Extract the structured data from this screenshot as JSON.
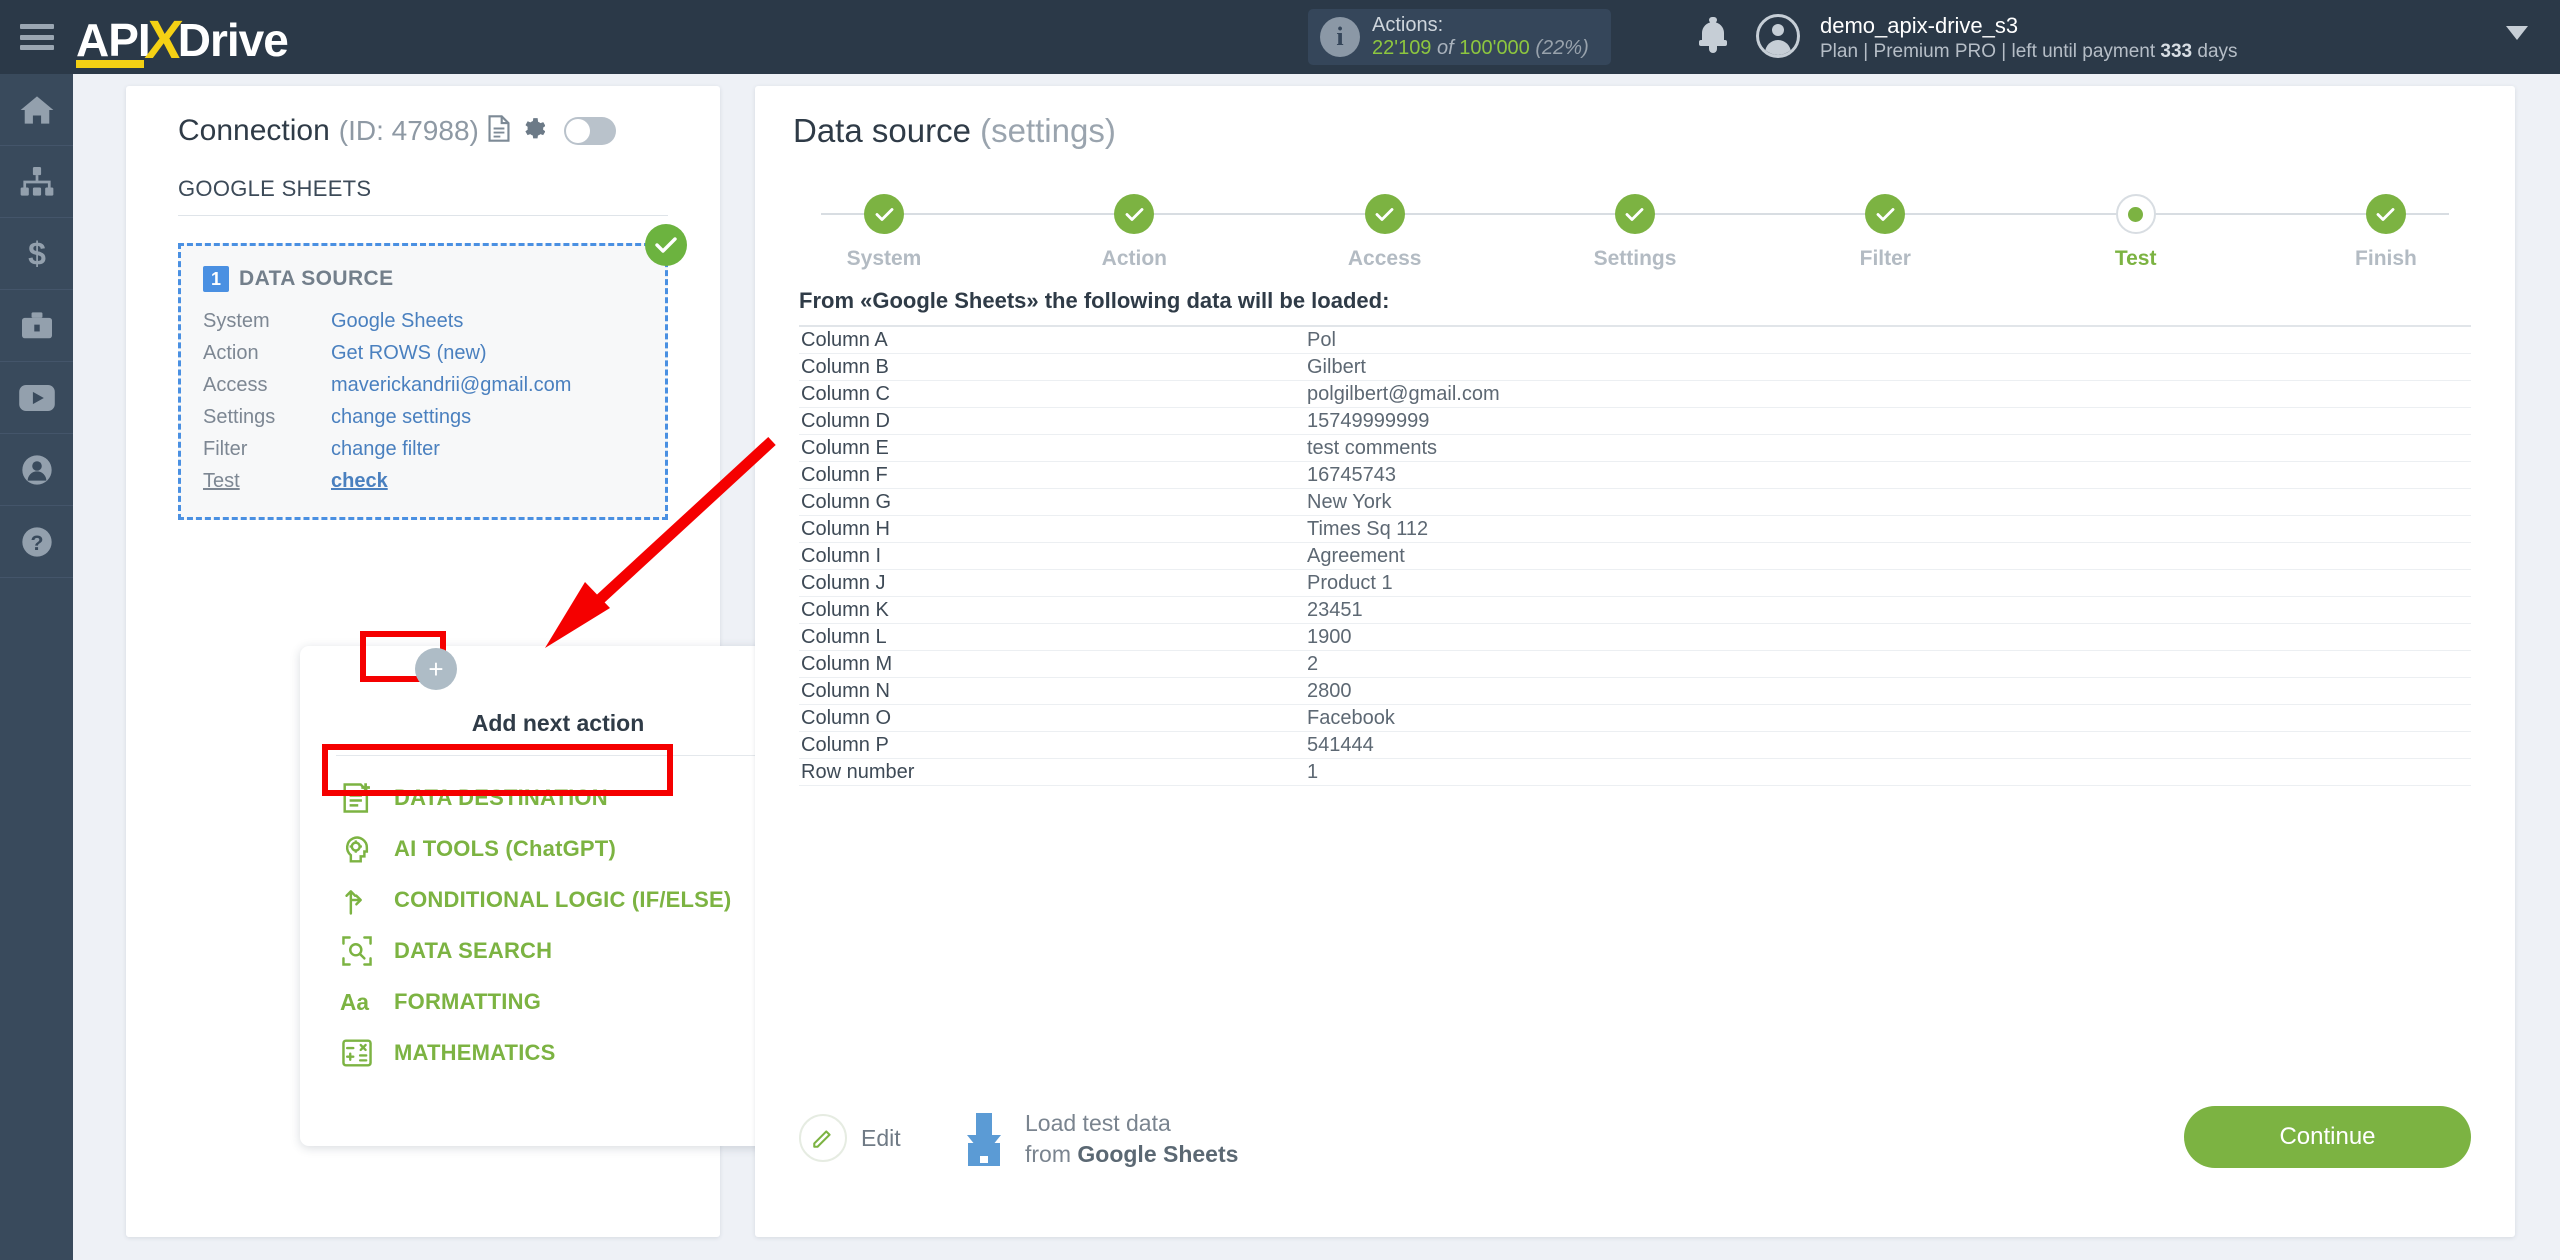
{
  "topbar": {
    "menu_icon": "hamburger-icon",
    "logo": {
      "part1": "API",
      "x": "X",
      "part2": "Drive"
    },
    "actions": {
      "label": "Actions:",
      "used": "22'109",
      "of": "of",
      "total": "100'000",
      "percent": "(22%)",
      "info_icon": "info-icon"
    },
    "bell_icon": "notification-bell-icon",
    "avatar_icon": "user-avatar-icon",
    "user": {
      "name": "demo_apix-drive_s3",
      "plan_prefix": "Plan |",
      "plan_name": "Premium PRO",
      "plan_suffix": "| left until payment",
      "days_count": "333",
      "days_word": "days"
    },
    "caret_icon": "chevron-down-icon"
  },
  "rail": {
    "items": [
      {
        "name": "home-icon"
      },
      {
        "name": "connections-icon"
      },
      {
        "name": "billing-icon"
      },
      {
        "name": "briefcase-icon"
      },
      {
        "name": "youtube-icon"
      },
      {
        "name": "account-icon"
      },
      {
        "name": "help-icon"
      }
    ]
  },
  "left_panel": {
    "connection_title": "Connection",
    "connection_id": "(ID: 47988)",
    "doc_icon": "document-icon",
    "gear_icon": "gear-icon",
    "toggle": "connection-toggle",
    "system_label": "GOOGLE SHEETS",
    "data_source_card": {
      "number": "1",
      "title": "DATA SOURCE",
      "check_icon": "check-circle-icon",
      "rows": [
        {
          "key": "System",
          "value": "Google Sheets"
        },
        {
          "key": "Action",
          "value": "Get ROWS (new)"
        },
        {
          "key": "Access",
          "value": "maverickandrii@gmail.com"
        },
        {
          "key": "Settings",
          "value": "change settings"
        },
        {
          "key": "Filter",
          "value": "change filter"
        },
        {
          "key": "Test",
          "value": "check"
        }
      ]
    },
    "plus_button": "+",
    "add_next_action": {
      "title": "Add next action",
      "items": [
        {
          "label": "DATA DESTINATION",
          "icon": "data-destination-icon"
        },
        {
          "label": "AI TOOLS (ChatGPT)",
          "icon": "ai-tools-icon"
        },
        {
          "label": "CONDITIONAL LOGIC (IF/ELSE)",
          "icon": "conditional-logic-icon"
        },
        {
          "label": "DATA SEARCH",
          "icon": "data-search-icon"
        },
        {
          "label": "FORMATTING",
          "icon": "formatting-icon"
        },
        {
          "label": "MATHEMATICS",
          "icon": "mathematics-icon"
        }
      ]
    }
  },
  "main": {
    "title": "Data source",
    "title_sub": "(settings)",
    "steps": [
      {
        "label": "System",
        "state": "done"
      },
      {
        "label": "Action",
        "state": "done"
      },
      {
        "label": "Access",
        "state": "done"
      },
      {
        "label": "Settings",
        "state": "done"
      },
      {
        "label": "Filter",
        "state": "done"
      },
      {
        "label": "Test",
        "state": "current"
      },
      {
        "label": "Finish",
        "state": "done"
      }
    ],
    "from_line": "From «Google Sheets» the following data will be loaded:",
    "table": [
      {
        "field": "Column A",
        "value": "Pol"
      },
      {
        "field": "Column B",
        "value": "Gilbert"
      },
      {
        "field": "Column C",
        "value": "polgilbert@gmail.com"
      },
      {
        "field": "Column D",
        "value": "15749999999"
      },
      {
        "field": "Column E",
        "value": "test comments"
      },
      {
        "field": "Column F",
        "value": "16745743"
      },
      {
        "field": "Column G",
        "value": "New York"
      },
      {
        "field": "Column H",
        "value": "Times Sq 112"
      },
      {
        "field": "Column I",
        "value": "Agreement"
      },
      {
        "field": "Column J",
        "value": "Product 1"
      },
      {
        "field": "Column K",
        "value": "23451"
      },
      {
        "field": "Column L",
        "value": "1900"
      },
      {
        "field": "Column M",
        "value": "2"
      },
      {
        "field": "Column N",
        "value": "2800"
      },
      {
        "field": "Column O",
        "value": "Facebook"
      },
      {
        "field": "Column P",
        "value": "541444"
      },
      {
        "field": "Row number",
        "value": "1"
      }
    ],
    "edit_label": "Edit",
    "edit_icon": "pencil-icon",
    "load_icon": "download-icon",
    "load_line1": "Load test data",
    "load_line2_prefix": "from",
    "load_line2_bold": "Google Sheets",
    "continue_label": "Continue"
  },
  "colors": {
    "topbar": "#2b3948",
    "rail": "#394a5c",
    "green": "#7cb342",
    "blue": "#4a90e2",
    "yellow": "#f5d114",
    "highlight_red": "#f50000"
  }
}
